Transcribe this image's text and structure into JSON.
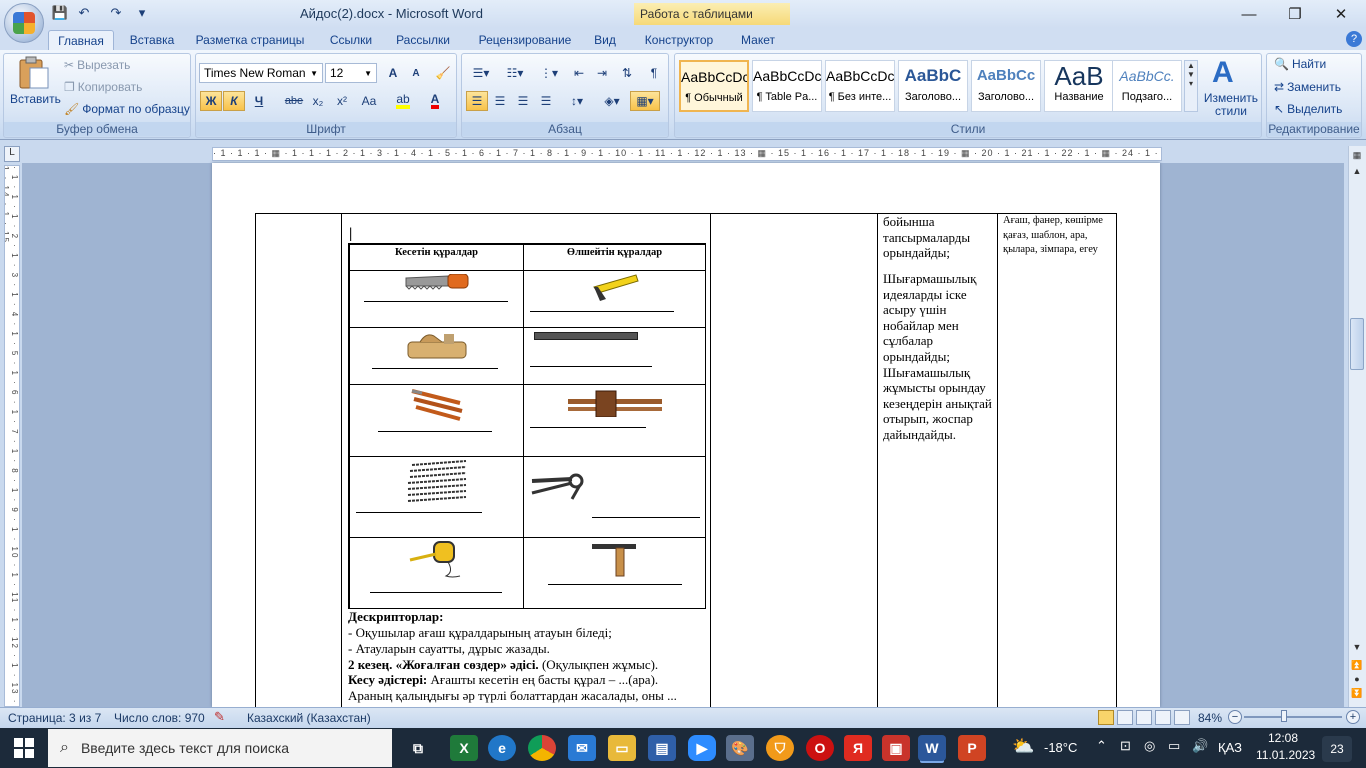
{
  "window": {
    "title": "Айдос(2).docx - Microsoft Word",
    "contextual_tab": "Работа с таблицами",
    "minimize": "—",
    "restore": "❐",
    "close": "✕"
  },
  "quick_access": {
    "save": "💾",
    "undo": "↶",
    "redo": "↷",
    "more": "▾"
  },
  "tabs": [
    "Главная",
    "Вставка",
    "Разметка страницы",
    "Ссылки",
    "Рассылки",
    "Рецензирование",
    "Вид",
    "Конструктор",
    "Макет"
  ],
  "active_tab": "Главная",
  "ribbon": {
    "clipboard": {
      "label": "Буфер обмена",
      "paste": "Вставить",
      "cut": "Вырезать",
      "copy": "Копировать",
      "format_painter": "Формат по образцу"
    },
    "font": {
      "label": "Шрифт",
      "font_name": "Times New Roman",
      "font_size": "12",
      "bold": "Ж",
      "italic": "К",
      "underline": "Ч",
      "strike": "abe",
      "subscript": "x₂",
      "superscript": "x²",
      "change_case": "Aa",
      "grow": "A",
      "shrink": "A"
    },
    "paragraph": {
      "label": "Абзац"
    },
    "styles": {
      "label": "Стили",
      "items": [
        {
          "sample": "AaBbCcDc",
          "name": "¶ Обычный"
        },
        {
          "sample": "AaBbCcDc",
          "name": "¶ Table Pa..."
        },
        {
          "sample": "AaBbCcDc",
          "name": "¶ Без инте..."
        },
        {
          "sample": "AaBbC",
          "name": "Заголово..."
        },
        {
          "sample": "AaBbCc",
          "name": "Заголово..."
        },
        {
          "sample": "AaB",
          "name": "Название"
        },
        {
          "sample": "AaBbCc.",
          "name": "Подзаго..."
        }
      ],
      "change_styles": "Изменить стили"
    },
    "editing": {
      "label": "Редактирование",
      "find": "Найти",
      "replace": "Заменить",
      "select": "Выделить"
    }
  },
  "ruler": {
    "horizontal": "· 1 · 1 · 1 · ▦ · 1 · 1 · 1 · 2 · 1 · 3 · 1 · 4 · 1 · 5 · 1 · 6 · 1 · 7 · 1 · 8 · 1 · 9 · 1 · 10 · 1 · 11 · 1 · 12 · 1 · 13 · ▦ · 15 · 1 · 16 · 1 · 17 · 1 · 18 · 1 · 19 · ▦ · 20 · 1 · 21 · 1 · 22 · 1 · ▦ · 24 · 1 · 25 · 1 · 26 · 1 · ▦ 7 · 28",
    "vertical": "· 1 · 1 · 1 · 2 · 1 · 3 · 1 · 4 · 1 · 5 · 1 · 6 · 1 · 7 · 1 · 8 · 1 · 9 · 1 · 10 · 1 · 11 · 1 · 12 · 1 · 13 · 1 · 14 · 1 · 15"
  },
  "document": {
    "cursor_mark": "|",
    "tools_table": {
      "headers": [
        "Кесетін құралдар",
        "Өлшейтін құралдар"
      ],
      "rows": [
        [
          "saw",
          "square"
        ],
        [
          "plane",
          "ruler"
        ],
        [
          "chisels",
          "marking-gauge"
        ],
        [
          "drill-bits",
          "compass"
        ],
        [
          "tape-measure",
          "try-square"
        ]
      ]
    },
    "descriptors_title": "Дескрипторлар:",
    "descriptors": [
      "-  Оқушылар ағаш құралдарының атауын біледі;",
      "-  Атауларын сауатты, дұрыс жазады."
    ],
    "stage_bold": "2 кезең. «Жоғалған сөздер» әдісі.",
    "stage_rest": " (Оқулықпен жұмыс).",
    "method_bold": "Кесу әдістері:",
    "method_rest": " Ағашты кесетін ең басты құрал – ...(ара).",
    "method_line2": "Араның қалыңдығы әр түрлі болаттардан жасалады, оны ...",
    "col4_p1": "бойынша тапсырмаларды орындайды;",
    "col4_p2": "Шығармашылық идеяларды іске асыру үшін нобайлар мен сұлбалар орындайды; Шығамашылық жұмысты орындау кезеңдерін анықтай отырып, жоспар дайындайды.",
    "col5": "Ағаш, фанер, көшірме қағаз, шаблон, ара, қылара, зімпара, егеу"
  },
  "status": {
    "page": "Страница: 3 из 7",
    "words": "Число слов: 970",
    "language": "Казахский (Казахстан)",
    "zoom": "84%",
    "zoom_percent": 84
  },
  "taskbar": {
    "search_placeholder": "Введите здесь текст для поиска",
    "weather": "-18°C",
    "lang": "ҚАЗ",
    "time": "12:08",
    "date": "11.01.2023",
    "notifications": "23"
  },
  "colors": {
    "ribbon": "#d7e4f5",
    "accent": "#15428b",
    "taskbar": "#1c2a3a"
  }
}
